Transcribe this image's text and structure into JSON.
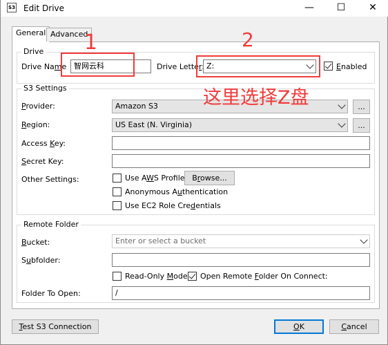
{
  "window": {
    "title": "Edit Drive",
    "icon_text": "S3",
    "minimize_glyph": "—",
    "maximize_glyph": "☐",
    "close_glyph": "✕"
  },
  "tabs": [
    {
      "label": "General",
      "active": true
    },
    {
      "label": "Advanced",
      "active": false
    }
  ],
  "drive": {
    "group_title": "Drive",
    "name_label_pre": "Drive Na",
    "name_label_u": "m",
    "name_label_post": "e",
    "name_value": "智网云科",
    "letter_label_pre": "Drive Lette",
    "letter_label_u": "r",
    "letter_value": "Z:",
    "enabled_label_pre": "",
    "enabled_label_u": "E",
    "enabled_label_post": "nabled",
    "enabled_checked": true
  },
  "s3": {
    "group_title": "S3 Settings",
    "provider_label_u": "P",
    "provider_label_post": "rovider:",
    "provider_value": "Amazon S3",
    "region_label_u": "R",
    "region_label_post": "egion:",
    "region_value": "US East (N. Virginia)",
    "ellipsis": "...",
    "access_key_label_pre": "Access ",
    "access_key_label_u": "K",
    "access_key_label_post": "ey:",
    "access_key_value": "",
    "secret_key_label_u": "S",
    "secret_key_label_post": "ecret Key:",
    "secret_key_value": "",
    "other_label": "Other Settings:",
    "use_aws_profile_pre": "Use A",
    "use_aws_profile_u": "W",
    "use_aws_profile_post": "S Profile",
    "browse_pre": "B",
    "browse_u": "r",
    "browse_post": "owse...",
    "anonymous_pre": "Anonymous A",
    "anonymous_u": "u",
    "anonymous_post": "thentication",
    "ec2_pre": "Use EC2 Role Cre",
    "ec2_u": "d",
    "ec2_post": "entials"
  },
  "remote": {
    "group_title": "Remote Folder",
    "bucket_label_u": "B",
    "bucket_label_post": "ucket:",
    "bucket_placeholder": "Enter or select a bucket",
    "subfolder_label_pre": "S",
    "subfolder_label_u": "u",
    "subfolder_label_post": "bfolder:",
    "subfolder_value": "",
    "readonly_pre": "Read-Only ",
    "readonly_u": "M",
    "readonly_post": "ode",
    "open_remote_pre": "Open Remote ",
    "open_remote_u": "F",
    "open_remote_post": "older On Connect:",
    "open_remote_checked": true,
    "folder_to_open_label": "Folder To Open:",
    "folder_to_open_value": "/"
  },
  "footer": {
    "test_pre": "",
    "test_u": "T",
    "test_post": "est S3 Connection",
    "ok_u": "O",
    "ok_post": "K",
    "cancel_u": "C",
    "cancel_post": "ancel"
  },
  "annotations": {
    "num1": "1",
    "num2": "2",
    "note": "这里选择Z盘",
    "color": "#f23b3b"
  }
}
